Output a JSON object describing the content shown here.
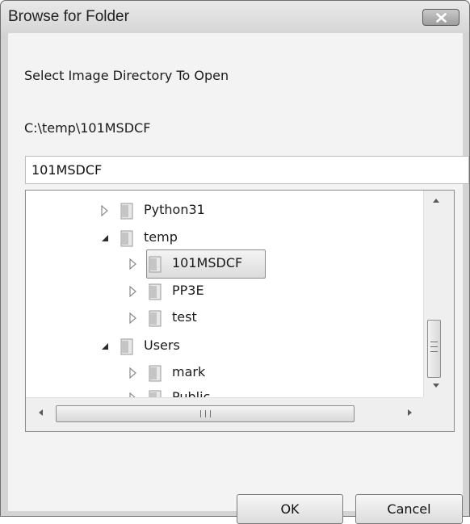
{
  "window": {
    "title": "Browse for Folder",
    "close_icon": "close-x-icon"
  },
  "dialog": {
    "prompt": "Select Image Directory To Open",
    "current_path": "C:\\temp\\101MSDCF",
    "folder_name_value": "101MSDCF"
  },
  "tree": {
    "items": [
      {
        "label": "Python31",
        "expanded": false,
        "selected": false,
        "level": 1,
        "icon": "folder-icon"
      },
      {
        "label": "temp",
        "expanded": true,
        "selected": false,
        "level": 1,
        "icon": "folder-icon"
      },
      {
        "label": "101MSDCF",
        "expanded": false,
        "selected": true,
        "level": 2,
        "icon": "folder-icon"
      },
      {
        "label": "PP3E",
        "expanded": false,
        "selected": false,
        "level": 2,
        "icon": "folder-icon"
      },
      {
        "label": "test",
        "expanded": false,
        "selected": false,
        "level": 2,
        "icon": "folder-icon"
      },
      {
        "label": "Users",
        "expanded": true,
        "selected": false,
        "level": 1,
        "icon": "folder-icon"
      },
      {
        "label": "mark",
        "expanded": false,
        "selected": false,
        "level": 2,
        "icon": "folder-icon"
      },
      {
        "label": "Public",
        "expanded": false,
        "selected": false,
        "level": 2,
        "icon": "folder-icon"
      }
    ]
  },
  "buttons": {
    "ok": "OK",
    "cancel": "Cancel"
  },
  "colors": {
    "window_frame": "#d3d3d3",
    "client_bg": "#f3f3f3",
    "selection_border": "#8b8b8b"
  }
}
